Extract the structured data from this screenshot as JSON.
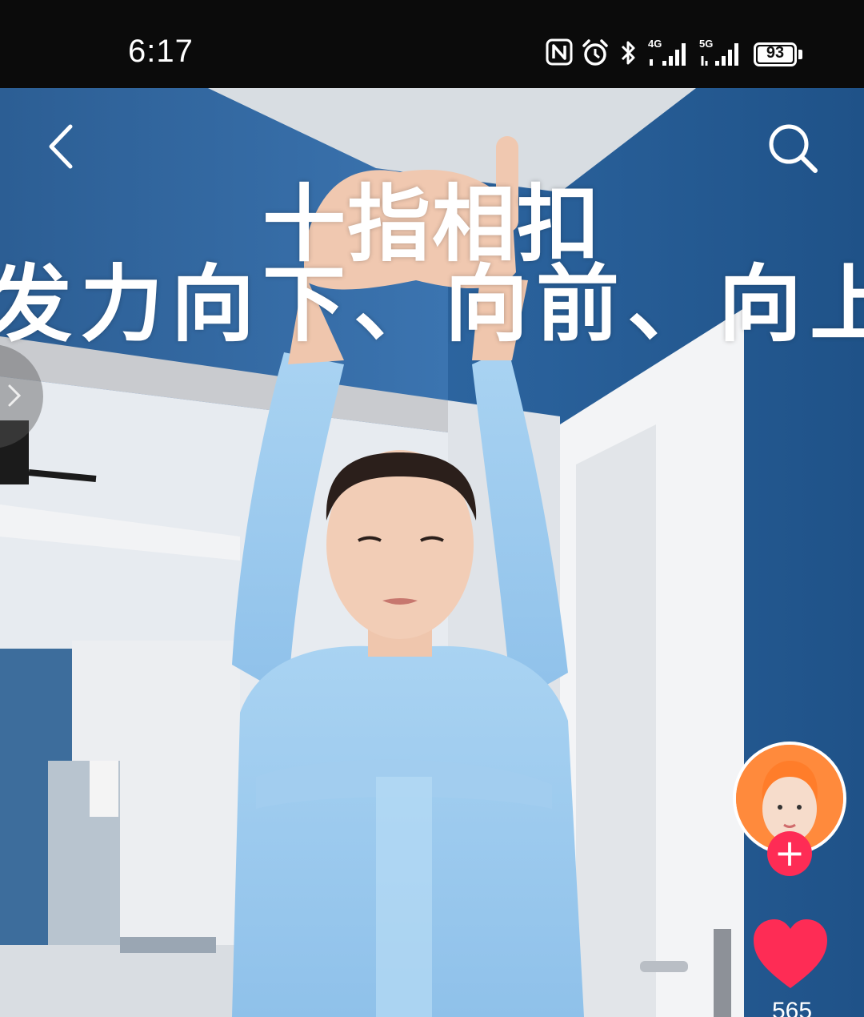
{
  "status_bar": {
    "time": "6:17",
    "network_1": "4G",
    "network_2": "5G",
    "battery": "93",
    "icons": [
      "nfc-icon",
      "alarm-icon",
      "bluetooth-icon",
      "signal-4g-icon",
      "signal-5g-icon",
      "battery-icon"
    ]
  },
  "video": {
    "overlay_title": "十指相扣",
    "overlay_subtitle": "发力向下、向前、向上推"
  },
  "actions": {
    "follow_label": "+",
    "like_count": "565",
    "like_color": "#fe2c55"
  },
  "nav": {
    "back_icon": "back-arrow-icon",
    "search_icon": "search-icon",
    "side_tab_icon": "chevron-right-icon"
  }
}
